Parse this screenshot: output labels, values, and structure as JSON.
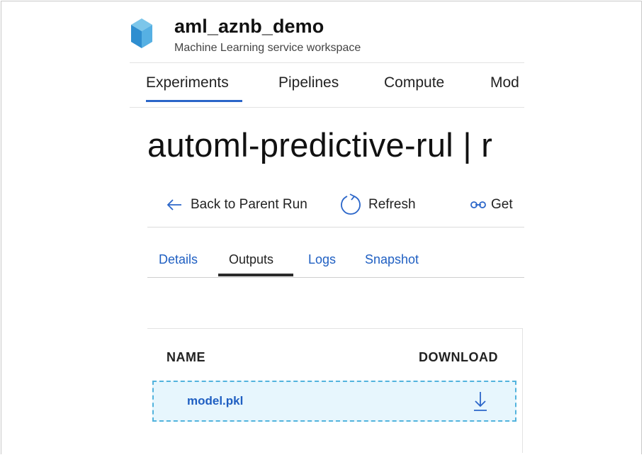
{
  "workspace": {
    "name": "aml_aznb_demo",
    "subtitle": "Machine Learning service workspace",
    "logo_icon": "cube-icon"
  },
  "top_nav": {
    "tabs": [
      {
        "label": "Experiments",
        "active": true
      },
      {
        "label": "Pipelines",
        "active": false
      },
      {
        "label": "Compute",
        "active": false
      },
      {
        "label": "Mod",
        "active": false
      }
    ]
  },
  "page": {
    "title": "automl-predictive-rul | r"
  },
  "toolbar": {
    "back_label": "Back to Parent Run",
    "back_icon": "arrow-left-icon",
    "refresh_label": "Refresh",
    "refresh_icon": "refresh-icon",
    "get_label": "Get",
    "get_icon": "link-icon"
  },
  "sub_tabs": {
    "tabs": [
      {
        "label": "Details",
        "active": false
      },
      {
        "label": "Outputs",
        "active": true
      },
      {
        "label": "Logs",
        "active": false
      },
      {
        "label": "Snapshot",
        "active": false
      }
    ]
  },
  "outputs_table": {
    "columns": [
      "NAME",
      "DOWNLOAD"
    ],
    "rows": [
      {
        "name": "model.pkl",
        "download_icon": "download-icon"
      }
    ]
  },
  "colors": {
    "accent": "#2b66c9",
    "link": "#1f5fc2",
    "row_highlight": "#e7f6fd",
    "row_border": "#52b3dd"
  }
}
